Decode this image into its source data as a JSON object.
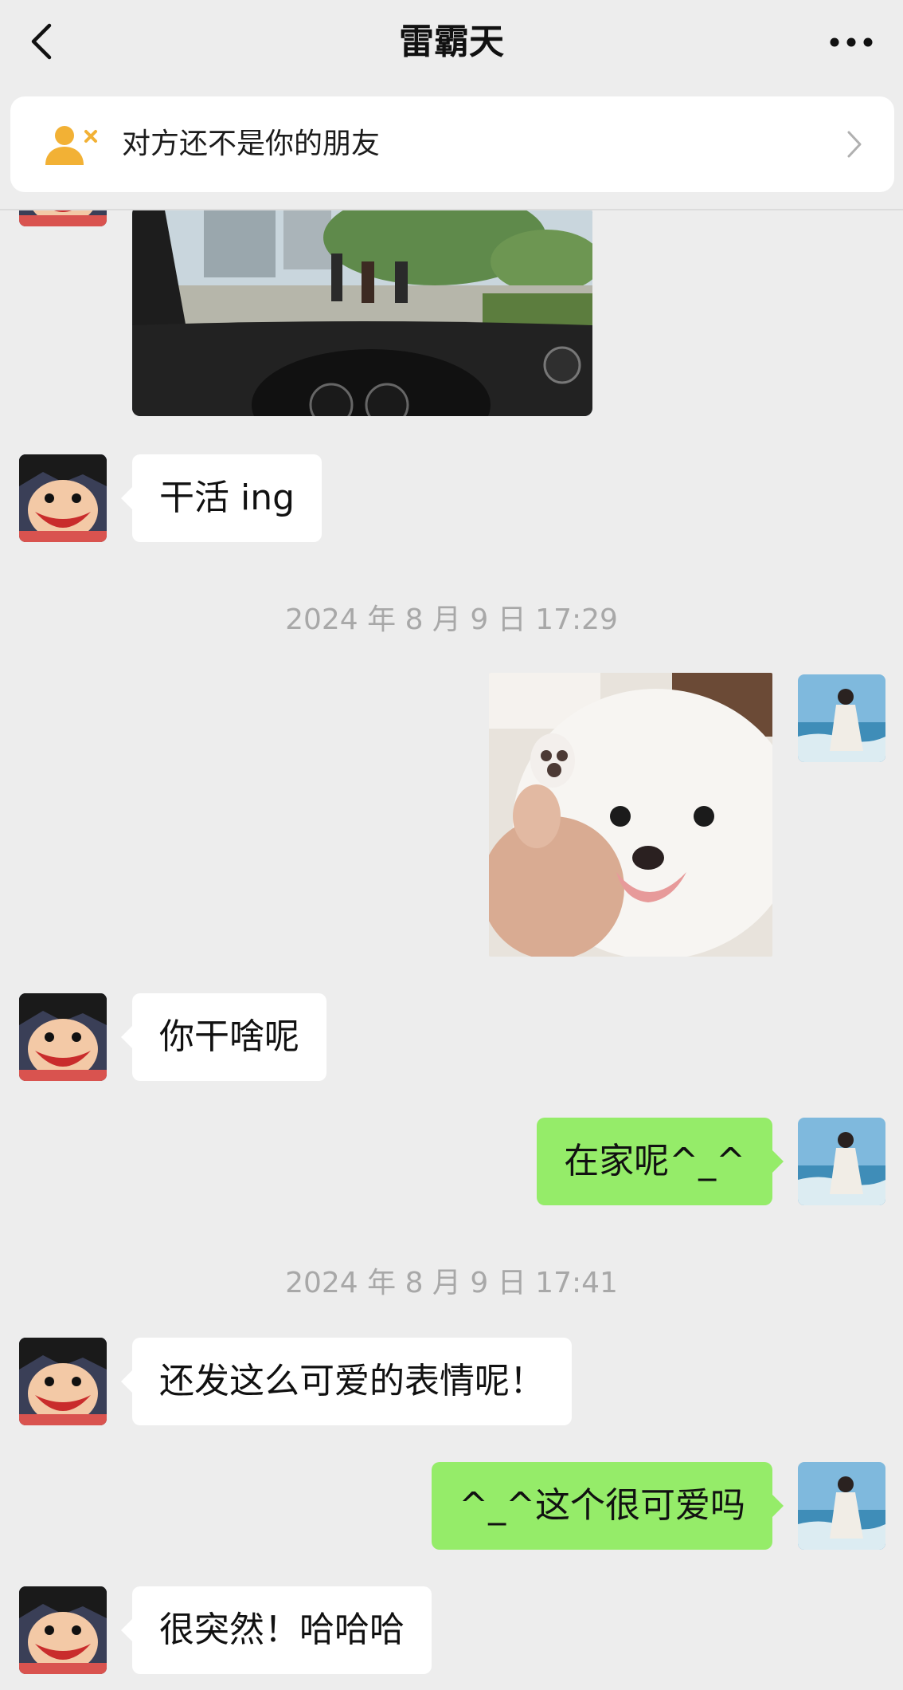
{
  "nav": {
    "title": "雷霸天",
    "back_icon": "chevron-left-icon",
    "more_icon": "more-dots-icon"
  },
  "banner": {
    "icon": "user-remove-icon",
    "text": "对方还不是你的朋友",
    "chevron": "chevron-right-icon"
  },
  "colors": {
    "background": "#ededed",
    "incoming_bubble": "#ffffff",
    "outgoing_bubble": "#95ec69",
    "banner_icon": "#f2b135",
    "timestamp_text": "#a8a8a8"
  },
  "messages": [
    {
      "type": "image",
      "side": "left",
      "image": "car-dashboard-street-photo"
    },
    {
      "type": "text",
      "side": "left",
      "text": "干活 ing"
    },
    {
      "type": "timestamp",
      "text": "2024 年 8 月 9 日 17:29"
    },
    {
      "type": "image",
      "side": "right",
      "image": "white-pomeranian-dog-sticker"
    },
    {
      "type": "text",
      "side": "left",
      "text": "你干啥呢"
    },
    {
      "type": "text",
      "side": "right",
      "text": "在家呢^_^"
    },
    {
      "type": "timestamp",
      "text": "2024 年 8 月 9 日 17:41"
    },
    {
      "type": "text",
      "side": "left",
      "text": "还发这么可爱的表情呢！"
    },
    {
      "type": "text",
      "side": "right",
      "text": "^_^这个很可爱吗"
    },
    {
      "type": "text",
      "side": "left",
      "text": "很突然！哈哈哈"
    }
  ]
}
